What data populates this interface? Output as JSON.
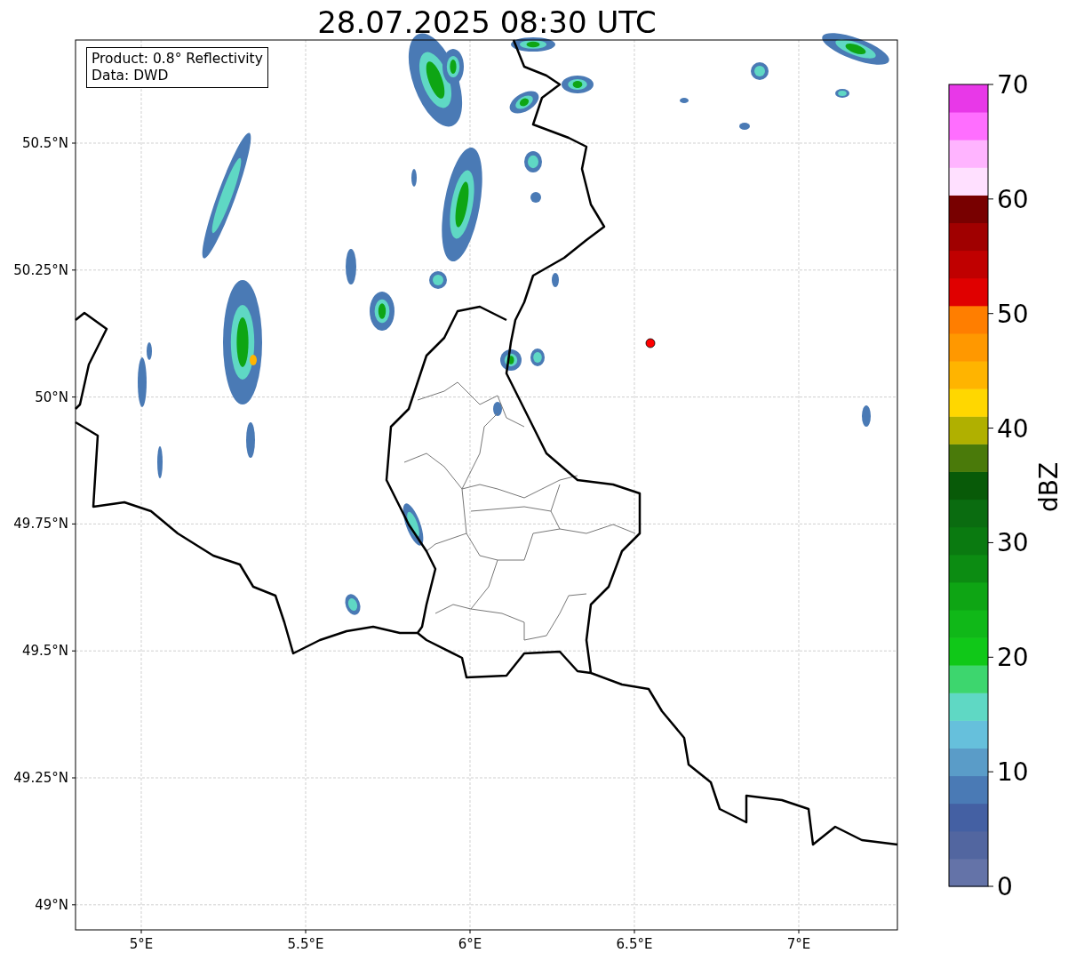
{
  "title": "28.07.2025 08:30 UTC",
  "info_box": {
    "lines": [
      "Product: 0.8° Reflectivity",
      "Data: DWD"
    ]
  },
  "map": {
    "lat_ticks": [
      "50.5°N",
      "50.25°N",
      "50°N",
      "49.75°N",
      "49.5°N",
      "49.25°N",
      "49°N"
    ],
    "lon_ticks": [
      "5°E",
      "5.5°E",
      "6°E",
      "6.5°E",
      "7°E"
    ]
  },
  "colorbar": {
    "label": "dBZ",
    "ticks": [
      "70",
      "60",
      "50",
      "40",
      "30",
      "20",
      "10",
      "0"
    ],
    "segments": [
      {
        "color": "#6473a8"
      },
      {
        "color": "#5266a0"
      },
      {
        "color": "#4460a3"
      },
      {
        "color": "#4a7ab5"
      },
      {
        "color": "#5a9cc8"
      },
      {
        "color": "#66c0dc"
      },
      {
        "color": "#5fd8c4"
      },
      {
        "color": "#3dd66e"
      },
      {
        "color": "#10c818"
      },
      {
        "color": "#10b818"
      },
      {
        "color": "#0ea514"
      },
      {
        "color": "#0c8c12"
      },
      {
        "color": "#0a7a10"
      },
      {
        "color": "#0a6c10"
      },
      {
        "color": "#085a08"
      },
      {
        "color": "#4a7a0a"
      },
      {
        "color": "#b0b000"
      },
      {
        "color": "#ffd700"
      },
      {
        "color": "#ffb400"
      },
      {
        "color": "#ff9800"
      },
      {
        "color": "#ff7e00"
      },
      {
        "color": "#e00000"
      },
      {
        "color": "#c00000"
      },
      {
        "color": "#a00000"
      },
      {
        "color": "#780000"
      },
      {
        "color": "#ffe0ff"
      },
      {
        "color": "#ffb4ff"
      },
      {
        "color": "#ff6eff"
      },
      {
        "color": "#e838e8"
      }
    ]
  }
}
